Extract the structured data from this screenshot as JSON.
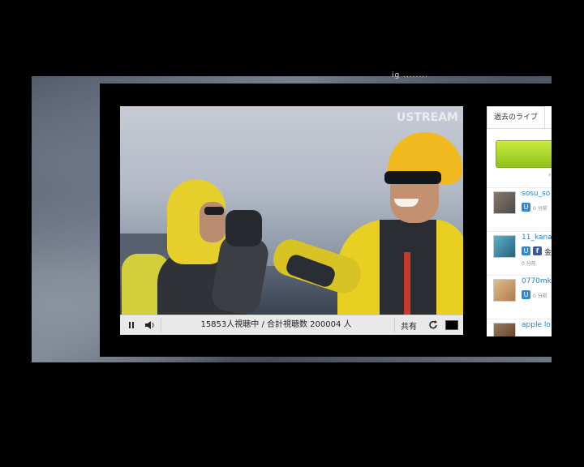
{
  "background": {
    "header_text": "ig ........"
  },
  "player": {
    "watermark": "USTREAM",
    "viewer_count": "15853人視聴中 /  合計視聴数  200004 人",
    "share_label": "共有"
  },
  "sidebar": {
    "tab_label": "過去のライブ",
    "users": [
      {
        "name": "sosu_so",
        "time": "0 分前"
      },
      {
        "name": "11_kana",
        "extra": "金",
        "time": "0 分前"
      },
      {
        "name": "0770mk",
        "time": "0 分前"
      },
      {
        "name": "apple lo"
      }
    ]
  },
  "colors": {
    "accent_green": "#9ccd22",
    "link_blue": "#2b7fc2",
    "ustream_badge": "#2f88d0",
    "facebook_badge": "#3b5998"
  },
  "icons": {
    "pause": "pause-icon",
    "volume": "volume-icon",
    "refresh": "refresh-icon",
    "fullscreen": "fullscreen-icon"
  }
}
